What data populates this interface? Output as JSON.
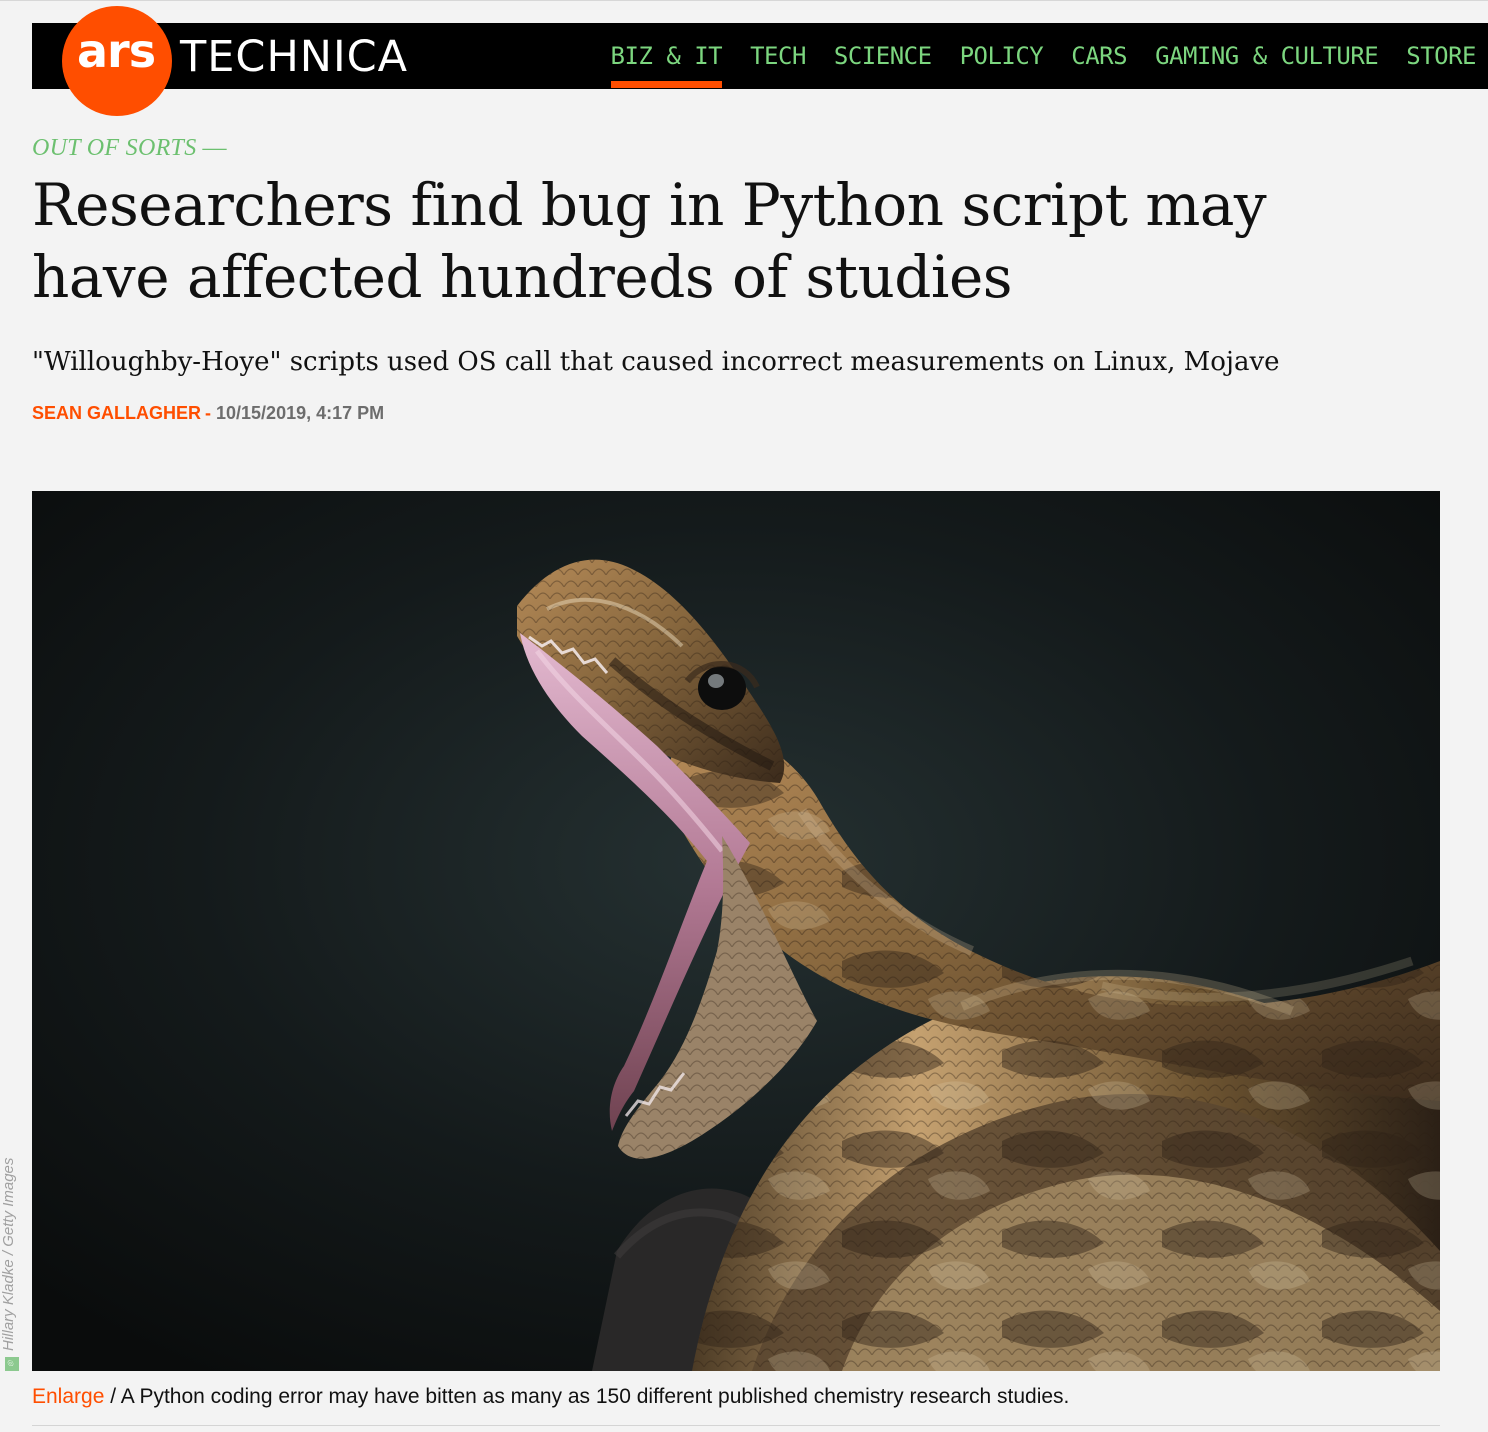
{
  "site": {
    "logo_ars": "ars",
    "logo_technica": "TECHNICA",
    "accent": "#ff4e00",
    "nav_color": "#7cd67f"
  },
  "nav": {
    "items": [
      {
        "label": "BIZ & IT",
        "active": true
      },
      {
        "label": "TECH",
        "active": false
      },
      {
        "label": "SCIENCE",
        "active": false
      },
      {
        "label": "POLICY",
        "active": false
      },
      {
        "label": "CARS",
        "active": false
      },
      {
        "label": "GAMING & CULTURE",
        "active": false
      },
      {
        "label": "STORE",
        "active": false
      }
    ]
  },
  "article": {
    "kicker": "OUT OF SORTS",
    "kicker_dash": "—",
    "title": "Researchers find bug in Python script may have affected hundreds of studies",
    "subtitle": "\"Willoughby-Hoye\" scripts used OS call that caused incorrect measurements on Linux, Mojave",
    "author": "SEAN GALLAGHER",
    "byline_sep": "-",
    "date": "10/15/2019, 4:17 PM"
  },
  "image": {
    "credit": "Hillary Kladke / Getty Images",
    "caption_link": "Enlarge",
    "caption_sep": "/",
    "caption": "A Python coding error may have bitten as many as 150 different published chemistry research studies.",
    "background_color": "#0e1010"
  }
}
